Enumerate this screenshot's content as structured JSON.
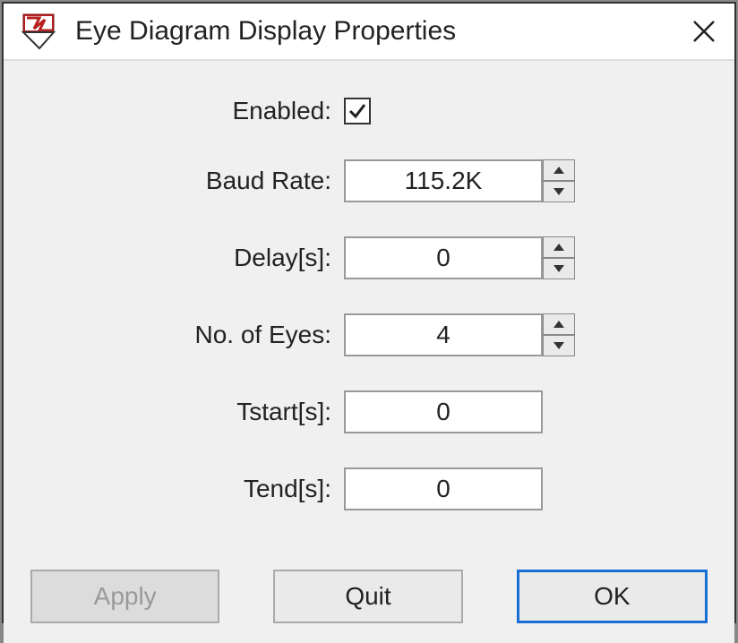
{
  "window": {
    "title": "Eye Diagram Display Properties"
  },
  "fields": {
    "enabled": {
      "label": "Enabled:",
      "checked": true
    },
    "baud_rate": {
      "label": "Baud Rate:",
      "value": "115.2K"
    },
    "delay": {
      "label": "Delay[s]:",
      "value": "0"
    },
    "no_of_eyes": {
      "label": "No. of Eyes:",
      "value": "4"
    },
    "tstart": {
      "label": "Tstart[s]:",
      "value": "0"
    },
    "tend": {
      "label": "Tend[s]:",
      "value": "0"
    }
  },
  "buttons": {
    "apply": "Apply",
    "quit": "Quit",
    "ok": "OK"
  }
}
